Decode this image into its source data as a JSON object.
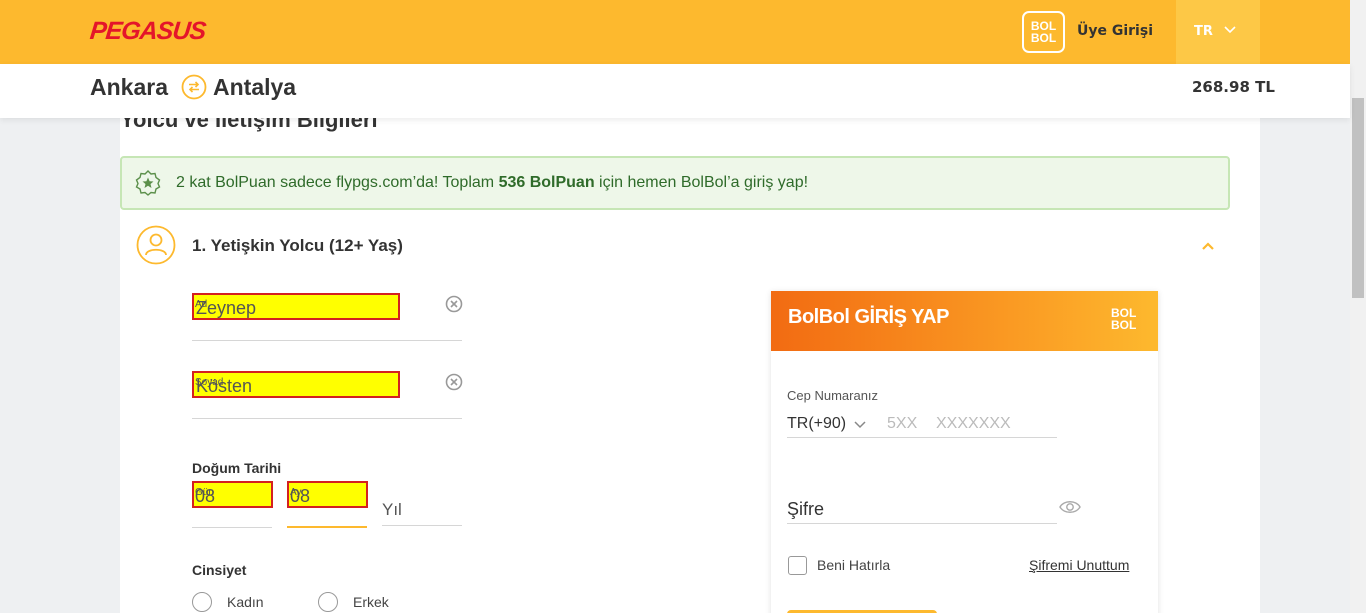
{
  "header": {
    "logo": "PEGASUS",
    "bolbol_badge_top": "BOL",
    "bolbol_badge_bottom": "BOL",
    "login_label": "Üye Girişi",
    "language": "TR"
  },
  "route": {
    "from": "Ankara",
    "to": "Antalya",
    "price": "268.98 TL"
  },
  "section": {
    "heading": "Yolcu ve İletişim Bilgileri"
  },
  "promo": {
    "text_before": "2 kat BolPuan sadece flypgs.com’da! Toplam ",
    "points": "536 BolPuan",
    "text_after": " için hemen BolBol’a giriş yap!"
  },
  "passenger": {
    "title": "1. Yetişkin Yolcu (12+ Yaş)",
    "first_name_label": "Ad",
    "first_name_value": "Zeynep",
    "last_name_label": "Soyad",
    "last_name_value": "Kösten",
    "birth_date_label": "Doğum Tarihi",
    "day_label": "Gün",
    "day_value": "08",
    "month_label": "Ay",
    "month_value": "08",
    "year_placeholder": "Yıl",
    "gender_label": "Cinsiyet",
    "gender_female": "Kadın",
    "gender_male": "Erkek"
  },
  "bolbol_login": {
    "title": "BolBol GİRİŞ YAP",
    "logo_top": "BOL",
    "logo_bottom": "BOL",
    "phone_label": "Cep Numaranız",
    "country_code": "TR(+90)",
    "area_placeholder": "5XX",
    "number_placeholder": "XXXXXXX",
    "password_label": "Şifre",
    "remember_me": "Beni Hatırla",
    "forgot_password": "Şifremi Unuttum"
  },
  "colors": {
    "brand_yellow": "#fdb92e",
    "brand_red": "#e4152a",
    "bolbol_orange": "#f26b12",
    "promo_green": "#2f6b2a"
  }
}
